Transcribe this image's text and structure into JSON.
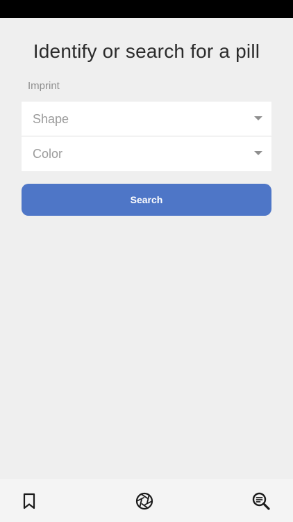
{
  "title": "Identify or search for a pill",
  "form": {
    "imprint_label": "Imprint",
    "shape_placeholder": "Shape",
    "color_placeholder": "Color",
    "search_label": "Search"
  },
  "colors": {
    "accent": "#4e76c7",
    "background": "#efefef",
    "title_text": "#2b2b2b",
    "placeholder_text": "#9b9b9b"
  },
  "tabs": [
    {
      "icon": "bookmark-icon"
    },
    {
      "icon": "camera-aperture-icon"
    },
    {
      "icon": "search-list-icon"
    }
  ]
}
